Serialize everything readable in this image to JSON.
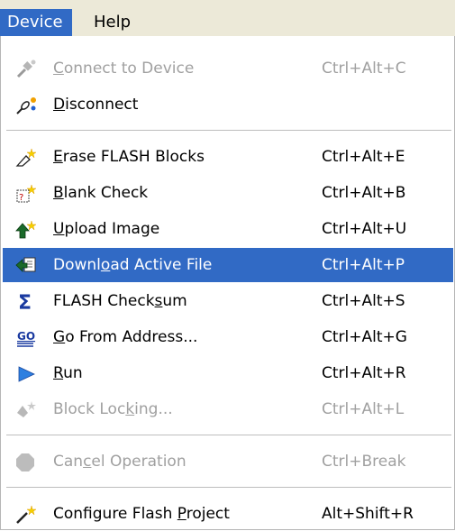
{
  "menubar": {
    "device": "Device",
    "help": "Help"
  },
  "menu": {
    "items": [
      {
        "label_pre": "",
        "label_ul": "C",
        "label_post": "onnect to Device",
        "shortcut": "Ctrl+Alt+C",
        "disabled": true
      },
      {
        "label_pre": "",
        "label_ul": "D",
        "label_post": "isconnect",
        "shortcut": "",
        "disabled": false
      },
      {
        "label_pre": "",
        "label_ul": "E",
        "label_post": "rase FLASH Blocks",
        "shortcut": "Ctrl+Alt+E",
        "disabled": false
      },
      {
        "label_pre": "",
        "label_ul": "B",
        "label_post": "lank Check",
        "shortcut": "Ctrl+Alt+B",
        "disabled": false
      },
      {
        "label_pre": "",
        "label_ul": "U",
        "label_post": "pload Image",
        "shortcut": "Ctrl+Alt+U",
        "disabled": false
      },
      {
        "label_pre": "Downl",
        "label_ul": "o",
        "label_post": "ad Active File",
        "shortcut": "Ctrl+Alt+P",
        "disabled": false,
        "selected": true
      },
      {
        "label_pre": "FLASH Check",
        "label_ul": "s",
        "label_post": "um",
        "shortcut": "Ctrl+Alt+S",
        "disabled": false
      },
      {
        "label_pre": "",
        "label_ul": "G",
        "label_post": "o From Address...",
        "shortcut": "Ctrl+Alt+G",
        "disabled": false
      },
      {
        "label_pre": "",
        "label_ul": "R",
        "label_post": "un",
        "shortcut": "Ctrl+Alt+R",
        "disabled": false
      },
      {
        "label_pre": "Block Loc",
        "label_ul": "k",
        "label_post": "ing...",
        "shortcut": "Ctrl+Alt+L",
        "disabled": true
      },
      {
        "label_pre": "Can",
        "label_ul": "c",
        "label_post": "el Operation",
        "shortcut": "Ctrl+Break",
        "disabled": true
      },
      {
        "label_pre": "Configure Flash ",
        "label_ul": "P",
        "label_post": "roject",
        "shortcut": "Alt+Shift+R",
        "disabled": false
      }
    ]
  }
}
